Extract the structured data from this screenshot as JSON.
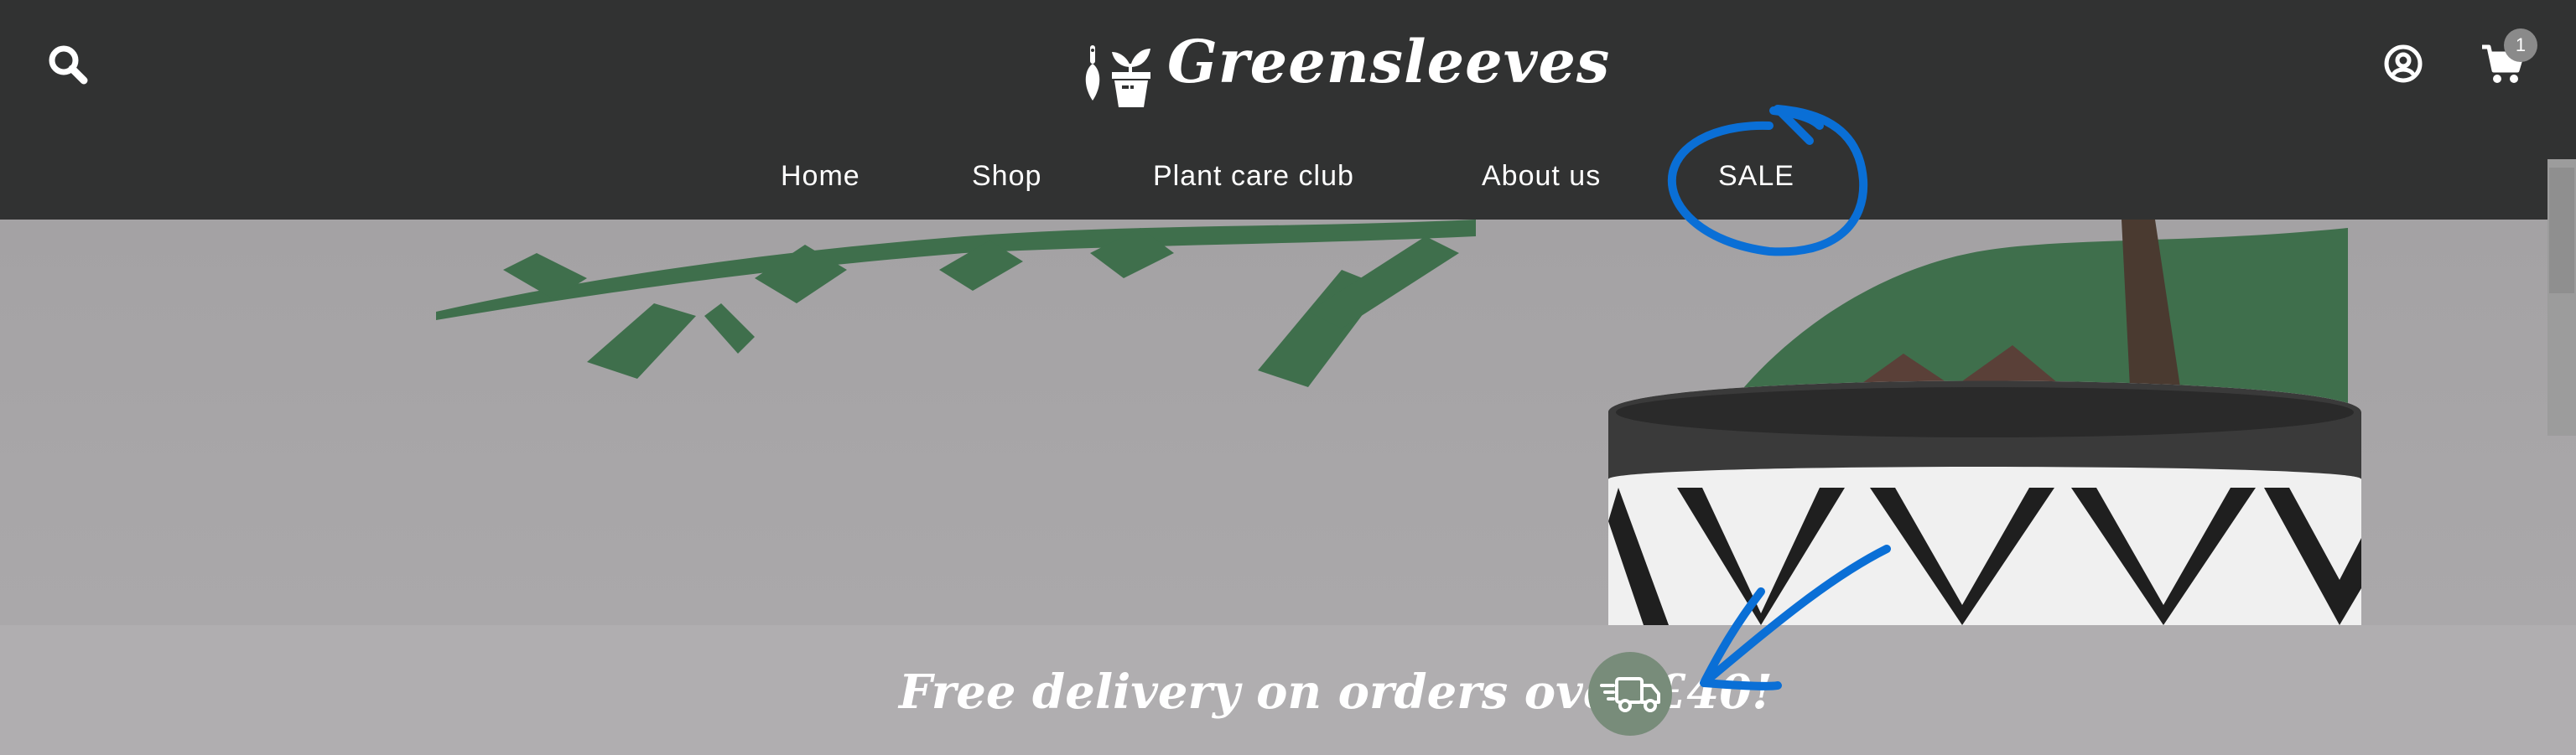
{
  "brand": {
    "name": "Greensleeves"
  },
  "header": {
    "icons": {
      "search": "search-icon",
      "account": "user-circle-icon",
      "cart": "shopping-cart-icon"
    },
    "cart_count": "1"
  },
  "nav": {
    "items": [
      {
        "label": "Home"
      },
      {
        "label": "Shop"
      },
      {
        "label": "Plant care club"
      },
      {
        "label": "About us"
      },
      {
        "label": "SALE"
      }
    ]
  },
  "banner": {
    "text": "Free delivery on orders over £40!",
    "icon": "delivery-truck-icon"
  },
  "colors": {
    "header_bg": "#313232",
    "hero_bg": "#a8a6a8",
    "banner_bg": "#b0aeb0",
    "truck_badge": "#788c7a",
    "annotation": "#0a6fd6"
  }
}
